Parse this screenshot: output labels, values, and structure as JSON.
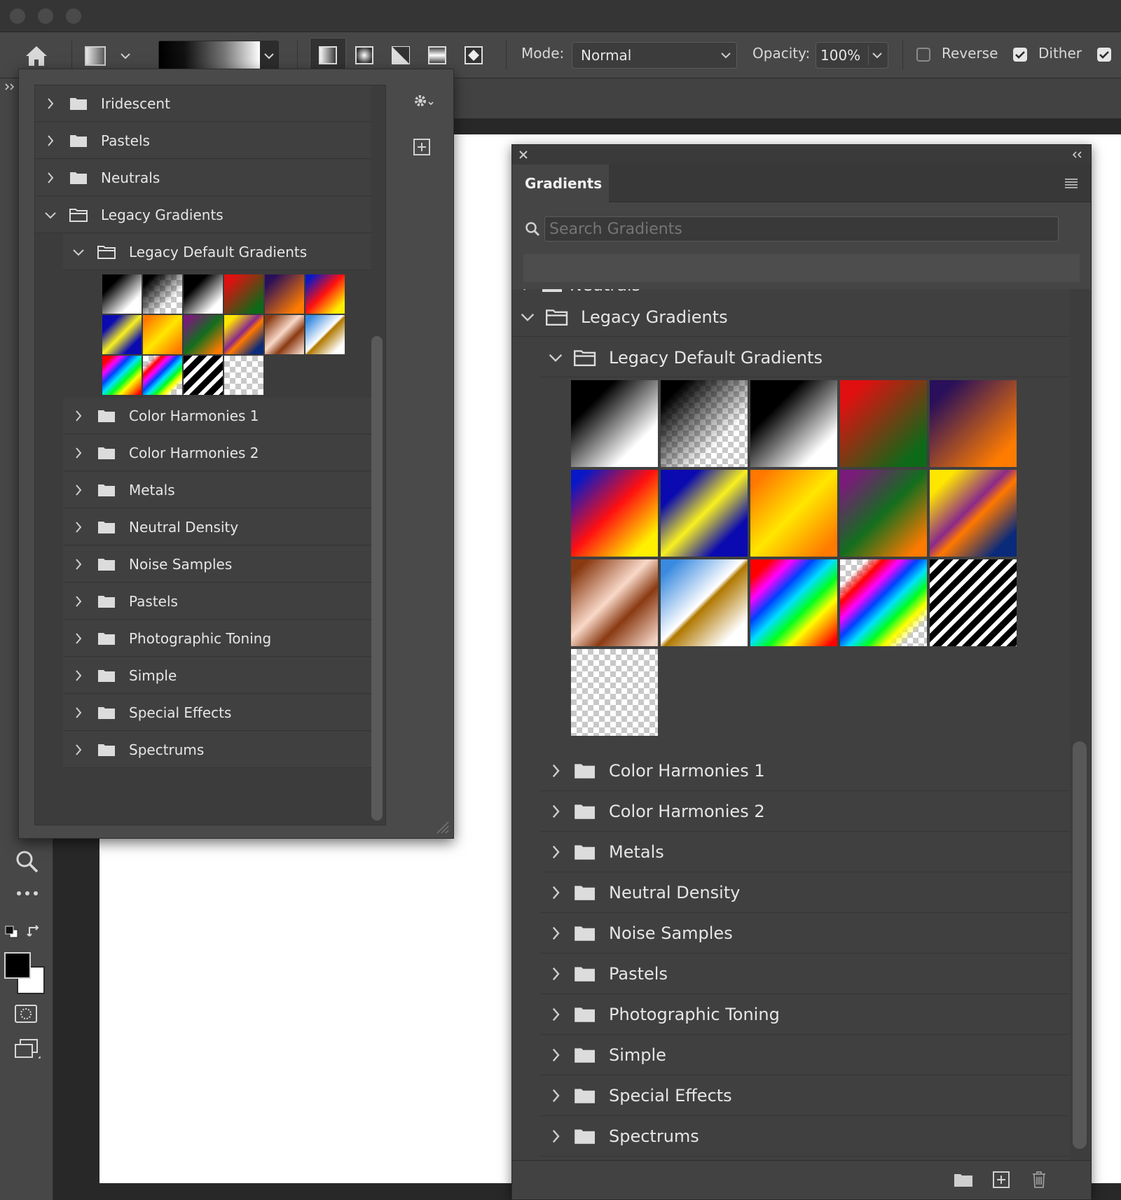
{
  "options_bar": {
    "mode_label": "Mode:",
    "mode_value": "Normal",
    "opacity_label": "Opacity:",
    "opacity_value": "100%",
    "reverse_label": "Reverse",
    "reverse_checked": false,
    "dither_label": "Dither",
    "dither_checked": true,
    "transparency_checked": true,
    "gradient_types": [
      "linear",
      "radial",
      "angle",
      "reflected",
      "diamond"
    ],
    "active_gradient_type": "linear"
  },
  "popup_picker": {
    "top_folders": [
      {
        "label": "Iridescent",
        "expanded": false
      },
      {
        "label": "Pastels",
        "expanded": false
      },
      {
        "label": "Neutrals",
        "expanded": false
      },
      {
        "label": "Legacy Gradients",
        "expanded": true
      }
    ],
    "subfolder_open": {
      "label": "Legacy Default Gradients",
      "expanded": true
    },
    "subfolders": [
      "Color Harmonies 1",
      "Color Harmonies 2",
      "Metals",
      "Neutral Density",
      "Noise Samples",
      "Pastels",
      "Photographic Toning",
      "Simple",
      "Special Effects",
      "Spectrums"
    ]
  },
  "gradients_panel": {
    "tab_label": "Gradients",
    "search_placeholder": "Search Gradients",
    "partial_folder": "Neutrals",
    "folder_open": {
      "label": "Legacy Gradients",
      "expanded": true
    },
    "subfolder_open": {
      "label": "Legacy Default Gradients",
      "expanded": true
    },
    "subfolders": [
      "Color Harmonies 1",
      "Color Harmonies 2",
      "Metals",
      "Neutral Density",
      "Noise Samples",
      "Pastels",
      "Photographic Toning",
      "Simple",
      "Special Effects",
      "Spectrums"
    ],
    "footer_icons": [
      "new-group-icon",
      "new-gradient-icon",
      "delete-icon"
    ]
  },
  "legacy_swatches": [
    {
      "name": "foreground-to-background",
      "css": "linear-gradient(135deg,#000 0%,#000 25%,#fff 75%,#fff 100%)"
    },
    {
      "name": "foreground-to-transparent",
      "css": "linear-gradient(135deg,#000 15%,rgba(0,0,0,0) 70%)",
      "checker": true
    },
    {
      "name": "black-white",
      "css": "linear-gradient(135deg,#000 0%,#000 30%,#fff 80%,#fff 100%)"
    },
    {
      "name": "red-green",
      "css": "linear-gradient(135deg,#e01010 15%,#0c6a18 85%)"
    },
    {
      "name": "violet-orange",
      "css": "linear-gradient(135deg,#2a0f5a 15%,#ff7c00 85%)"
    },
    {
      "name": "blue-red-yellow",
      "css": "linear-gradient(135deg,#0818c8 10%,#ff1010 48%,#ffef00 85%)"
    },
    {
      "name": "blue-yellow-blue",
      "css": "linear-gradient(135deg,#0a0ab0 22%,#f8f020 50%,#0a0ab0 78%)"
    },
    {
      "name": "orange-yellow-orange",
      "css": "linear-gradient(135deg,#ff7800 10%,#ffe600 50%,#ff7a00 90%)"
    },
    {
      "name": "violet-green-orange",
      "css": "linear-gradient(135deg,#7a1a7a 10%,#136e1e 50%,#ff7a00 90%)"
    },
    {
      "name": "yellow-violet-orange-blue",
      "css": "linear-gradient(135deg,#ffe600 15%,#8a2a8a 45%,#ff7800 55%,#0a2a7a 85%)"
    },
    {
      "name": "copper",
      "css": "linear-gradient(135deg,#8a3a12 10%,#f8d8c8 45%,#8a3a12 65%,#f0d0c0 95%)"
    },
    {
      "name": "chrome",
      "css": "linear-gradient(135deg,#3a8ae0 10%,#fff 48%,#b07800 52%,#fff 85%)"
    },
    {
      "name": "spectrum",
      "css": "linear-gradient(135deg,#ff0000 12%,#ff00ff 24%,#0040ff 36%,#00e0ff 48%,#00ff20 60%,#ffff00 72%,#ff8000 84%,#ff0000 95%)"
    },
    {
      "name": "transparent-rainbow",
      "css": "linear-gradient(135deg,rgba(255,0,0,0) 15%,#ff0000 25%,#ff00ff 35%,#0040ff 45%,#00e0ff 55%,#00ff20 65%,#ffff00 75%,rgba(255,128,0,0) 85%)",
      "checker": true
    },
    {
      "name": "transparent-stripes",
      "css": "repeating-linear-gradient(135deg,#000 0px,#000 9px,#fff 9px,#fff 15px)",
      "checker": true
    },
    {
      "name": "transparent",
      "css": "none",
      "checker": true
    }
  ]
}
